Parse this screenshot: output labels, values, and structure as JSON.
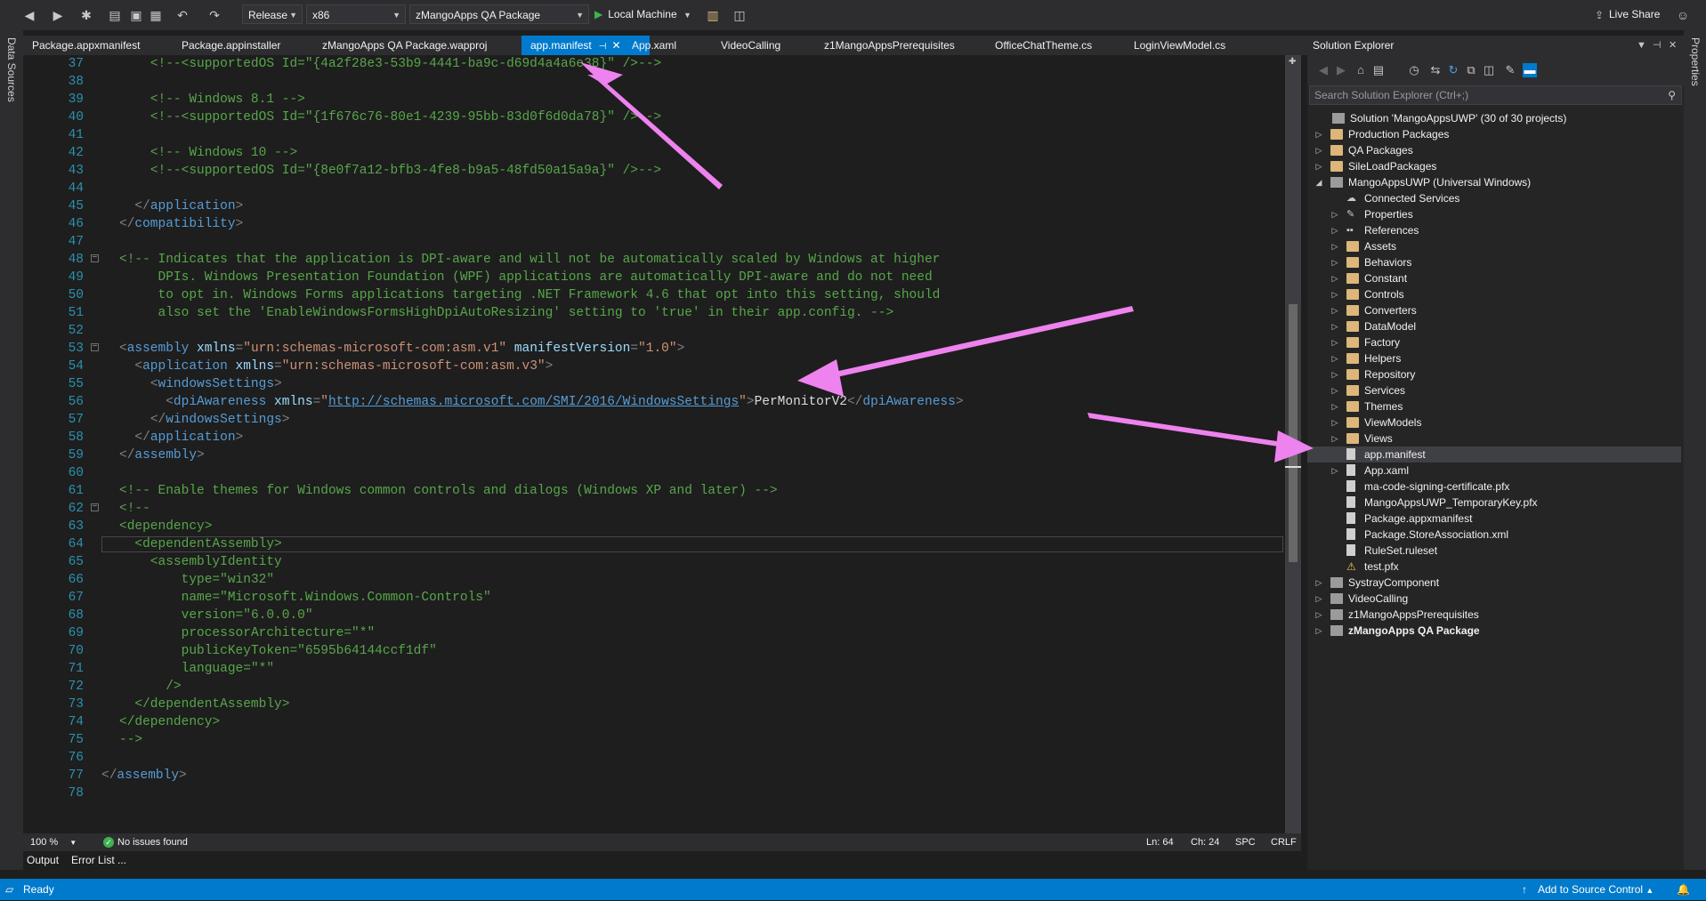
{
  "toolbar": {
    "configuration": "Release",
    "platform": "x86",
    "startup_project": "zMangoApps QA Package",
    "run_target": "Local Machine",
    "live_share": "Live Share"
  },
  "left_strip": {
    "label": "Data Sources"
  },
  "right_strip": {
    "label": "Properties"
  },
  "tabs": [
    {
      "label": "Package.appxmanifest"
    },
    {
      "label": "Package.appinstaller"
    },
    {
      "label": "zMangoApps QA Package.wapproj"
    },
    {
      "label": "app.manifest",
      "active": true
    },
    {
      "label": "App.xaml"
    },
    {
      "label": "VideoCalling"
    },
    {
      "label": "z1MangoAppsPrerequisites"
    },
    {
      "label": "OfficeChatTheme.cs"
    },
    {
      "label": "LoginViewModel.cs"
    }
  ],
  "editor": {
    "lines": [
      {
        "n": "37"
      },
      {
        "n": "38"
      },
      {
        "n": "39"
      },
      {
        "n": "40"
      },
      {
        "n": "41"
      },
      {
        "n": "42"
      },
      {
        "n": "43"
      },
      {
        "n": "44"
      },
      {
        "n": "45"
      },
      {
        "n": "46"
      },
      {
        "n": "47"
      },
      {
        "n": "48"
      },
      {
        "n": "49"
      },
      {
        "n": "50"
      },
      {
        "n": "51"
      },
      {
        "n": "52"
      },
      {
        "n": "53"
      },
      {
        "n": "54"
      },
      {
        "n": "55"
      },
      {
        "n": "56"
      },
      {
        "n": "57"
      },
      {
        "n": "58"
      },
      {
        "n": "59"
      },
      {
        "n": "60"
      },
      {
        "n": "61"
      },
      {
        "n": "62"
      },
      {
        "n": "63"
      },
      {
        "n": "64"
      },
      {
        "n": "65"
      },
      {
        "n": "66"
      },
      {
        "n": "67"
      },
      {
        "n": "68"
      },
      {
        "n": "69"
      },
      {
        "n": "70"
      },
      {
        "n": "71"
      },
      {
        "n": "72"
      },
      {
        "n": "73"
      },
      {
        "n": "74"
      },
      {
        "n": "75"
      },
      {
        "n": "76"
      },
      {
        "n": "77"
      },
      {
        "n": "78"
      }
    ],
    "code": {
      "l37": "<!--<supportedOS Id=\"{4a2f28e3-53b9-4441-ba9c-d69d4a4a6e38}\" />-->",
      "l39": "<!-- Windows 8.1 -->",
      "l40": "<!--<supportedOS Id=\"{1f676c76-80e1-4239-95bb-83d0f6d0da78}\" />-->",
      "l42": "<!-- Windows 10 -->",
      "l43": "<!--<supportedOS Id=\"{8e0f7a12-bfb3-4fe8-b9a5-48fd50a15a9a}\" />-->",
      "l45_tag": "application",
      "l46_tag": "compatibility",
      "l48": "<!-- Indicates that the application is DPI-aware and will not be automatically scaled by Windows at higher",
      "l49": "DPIs. Windows Presentation Foundation (WPF) applications are automatically DPI-aware and do not need",
      "l50": "to opt in. Windows Forms applications targeting .NET Framework 4.6 that opt into this setting, should",
      "l51": "also set the 'EnableWindowsFormsHighDpiAutoResizing' setting to 'true' in their app.config. -->",
      "l53_tag": "assembly",
      "l53_a1": "xmlns",
      "l53_v1": "\"urn:schemas-microsoft-com:asm.v1\"",
      "l53_a2": "manifestVersion",
      "l53_v2": "\"1.0\"",
      "l54_tag": "application",
      "l54_a1": "xmlns",
      "l54_v1": "\"urn:schemas-microsoft-com:asm.v3\"",
      "l55_tag": "windowsSettings",
      "l56_tag": "dpiAwareness",
      "l56_a1": "xmlns",
      "l56_url": "http://schemas.microsoft.com/SMI/2016/WindowsSettings",
      "l56_text": "PerMonitorV2",
      "l57_tag": "windowsSettings",
      "l58_tag": "application",
      "l59_tag": "assembly",
      "l61": "<!-- Enable themes for Windows common controls and dialogs (Windows XP and later) -->",
      "l62": "<!--",
      "l63": "<dependency>",
      "l64": "<dependentAssembly>",
      "l65": "<assemblyIdentity",
      "l66": "type=\"win32\"",
      "l67": "name=\"Microsoft.Windows.Common-Controls\"",
      "l68": "version=\"6.0.0.0\"",
      "l69": "processorArchitecture=\"*\"",
      "l70": "publicKeyToken=\"6595b64144ccf1df\"",
      "l71": "language=\"*\"",
      "l72": "/>",
      "l73": "</dependentAssembly>",
      "l74": "</dependency>",
      "l75": "-->",
      "l77_tag": "assembly"
    }
  },
  "editor_status": {
    "zoom": "100 %",
    "issues": "No issues found",
    "ln": "Ln: 64",
    "ch": "Ch: 24",
    "spc": "SPC",
    "crlf": "CRLF"
  },
  "output_tabs": [
    "Output",
    "Error List ..."
  ],
  "solution_explorer": {
    "title": "Solution Explorer",
    "search_placeholder": "Search Solution Explorer (Ctrl+;)",
    "items": [
      {
        "label": "Solution 'MangoAppsUWP' (30 of 30 projects)",
        "icon": "solution-icon",
        "level": 0,
        "expand": ""
      },
      {
        "label": "Production Packages",
        "icon": "folder-icon",
        "level": 0,
        "expand": "collapsed"
      },
      {
        "label": "QA Packages",
        "icon": "folder-icon",
        "level": 0,
        "expand": "collapsed"
      },
      {
        "label": "SileLoadPackages",
        "icon": "folder-icon",
        "level": 0,
        "expand": "collapsed"
      },
      {
        "label": "MangoAppsUWP (Universal Windows)",
        "icon": "project-icon",
        "level": 0,
        "expand": "expanded"
      },
      {
        "label": "Connected Services",
        "icon": "connected-services-icon",
        "level": 1,
        "expand": ""
      },
      {
        "label": "Properties",
        "icon": "wrench-icon",
        "level": 1,
        "expand": "collapsed"
      },
      {
        "label": "References",
        "icon": "references-icon",
        "level": 1,
        "expand": "collapsed"
      },
      {
        "label": "Assets",
        "icon": "folder-icon",
        "level": 1,
        "expand": "collapsed"
      },
      {
        "label": "Behaviors",
        "icon": "folder-icon",
        "level": 1,
        "expand": "collapsed"
      },
      {
        "label": "Constant",
        "icon": "folder-icon",
        "level": 1,
        "expand": "collapsed"
      },
      {
        "label": "Controls",
        "icon": "folder-icon",
        "level": 1,
        "expand": "collapsed"
      },
      {
        "label": "Converters",
        "icon": "folder-icon",
        "level": 1,
        "expand": "collapsed"
      },
      {
        "label": "DataModel",
        "icon": "folder-icon",
        "level": 1,
        "expand": "collapsed"
      },
      {
        "label": "Factory",
        "icon": "folder-icon",
        "level": 1,
        "expand": "collapsed"
      },
      {
        "label": "Helpers",
        "icon": "folder-icon",
        "level": 1,
        "expand": "collapsed"
      },
      {
        "label": "Repository",
        "icon": "folder-icon",
        "level": 1,
        "expand": "collapsed"
      },
      {
        "label": "Services",
        "icon": "folder-icon",
        "level": 1,
        "expand": "collapsed"
      },
      {
        "label": "Themes",
        "icon": "folder-icon",
        "level": 1,
        "expand": "collapsed"
      },
      {
        "label": "ViewModels",
        "icon": "folder-icon",
        "level": 1,
        "expand": "collapsed"
      },
      {
        "label": "Views",
        "icon": "folder-icon",
        "level": 1,
        "expand": "collapsed"
      },
      {
        "label": "app.manifest",
        "icon": "manifest-file-icon",
        "level": 1,
        "expand": "",
        "selected": true
      },
      {
        "label": "App.xaml",
        "icon": "file-icon",
        "level": 1,
        "expand": "collapsed"
      },
      {
        "label": "ma-code-signing-certificate.pfx",
        "icon": "file-icon",
        "level": 1,
        "expand": ""
      },
      {
        "label": "MangoAppsUWP_TemporaryKey.pfx",
        "icon": "file-icon",
        "level": 1,
        "expand": ""
      },
      {
        "label": "Package.appxmanifest",
        "icon": "file-icon",
        "level": 1,
        "expand": ""
      },
      {
        "label": "Package.StoreAssociation.xml",
        "icon": "file-icon",
        "level": 1,
        "expand": ""
      },
      {
        "label": "RuleSet.ruleset",
        "icon": "file-icon",
        "level": 1,
        "expand": ""
      },
      {
        "label": "test.pfx",
        "icon": "warning-file-icon",
        "level": 1,
        "expand": ""
      },
      {
        "label": "SystrayComponent",
        "icon": "project-icon",
        "level": 0,
        "expand": "collapsed"
      },
      {
        "label": "VideoCalling",
        "icon": "project-icon",
        "level": 0,
        "expand": "collapsed"
      },
      {
        "label": "z1MangoAppsPrerequisites",
        "icon": "project-icon",
        "level": 0,
        "expand": "collapsed"
      },
      {
        "label": "zMangoApps QA Package",
        "icon": "package-icon",
        "level": 0,
        "expand": "collapsed",
        "bold": true
      }
    ]
  },
  "statusbar": {
    "ready": "Ready",
    "source_control": "Add to Source Control"
  },
  "annotation_color": "#ee82ee",
  "accent_color": "#007acc"
}
